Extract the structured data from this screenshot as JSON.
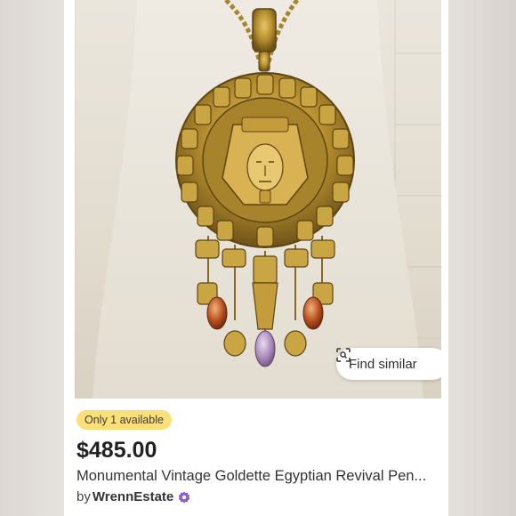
{
  "listing": {
    "availability_badge": "Only 1 available",
    "price": "$485.00",
    "title": "Monumental Vintage Goldette Egyptian Revival Pen...",
    "seller_prefix": "by",
    "seller_name": "WrennEstate"
  },
  "actions": {
    "find_similar_label": "Find similar"
  },
  "colors": {
    "badge": "#fbe07a",
    "verified_badge": "#8e5bd6",
    "gold": "#b8902f"
  },
  "icons": {
    "find_similar": "visual-search-icon",
    "verified": "verified-seller-icon"
  }
}
